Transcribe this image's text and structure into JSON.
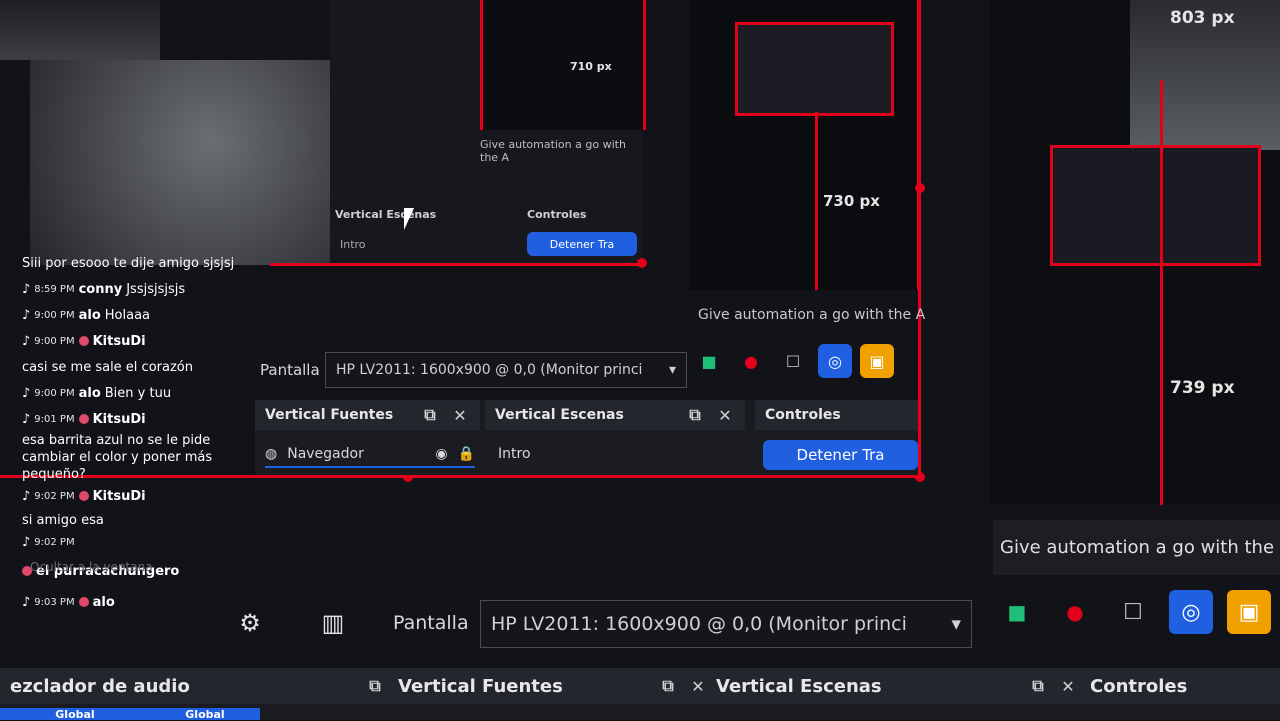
{
  "obs": {
    "px_labels": [
      "803 px",
      "730 px",
      "739 px",
      "710 px"
    ],
    "automation_text": "Give automation a go with the",
    "automation_text_short": "Give automation a go with the A",
    "pantalla_label": "Pantalla",
    "source_value": "HP LV2011: 1600x900 @ 0,0 (Monitor princi",
    "source_value_mid": "HP LV2011: 1600x900 @ 0,0 (Monitor princi",
    "docks": {
      "audio_mixer": "ezclador de audio",
      "vertical_sources": "Vertical Fuentes",
      "vertical_scenes": "Vertical Escenas",
      "controls": "Controles"
    },
    "browser_source": "Navegador",
    "scene_item": "Intro",
    "stop_button": "Detener Tra",
    "global_labels": [
      "Global",
      "Global"
    ],
    "hint_text": "Ocultar a la ventana"
  },
  "chat": [
    {
      "time": "",
      "user": "",
      "message": "Siii por esooo te dije amigo sjsjsj"
    },
    {
      "time": "8:59 PM",
      "user": "conny",
      "message": "Jssjsjsjsjs"
    },
    {
      "time": "9:00 PM",
      "user": "alo",
      "message": "Holaaa"
    },
    {
      "time": "9:00 PM",
      "user": "KitsuDi",
      "message": "casi se me sale el corazón"
    },
    {
      "time": "9:00 PM",
      "user": "alo",
      "message": "Bien y tuu"
    },
    {
      "time": "9:01 PM",
      "user": "KitsuDi",
      "message": "esa barrita azul no se le pide cambiar el color y poner más pequeño?"
    },
    {
      "time": "9:02 PM",
      "user": "KitsuDi",
      "message": "si amigo esa"
    },
    {
      "time": "9:02 PM",
      "user": "el purracachungero",
      "message": ""
    },
    {
      "time": "9:03 PM",
      "user": "alo",
      "message": ""
    }
  ],
  "colors": {
    "accent_red": "#e2001a",
    "accent_blue": "#1f5fe0",
    "accent_orange": "#f0a100",
    "accent_green": "#1fbf7a"
  }
}
